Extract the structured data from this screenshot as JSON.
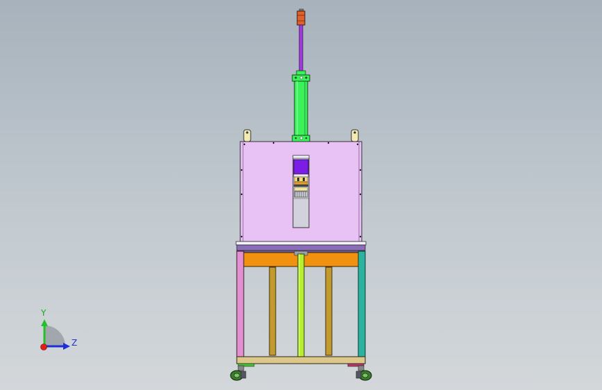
{
  "view": {
    "background_top": "#a7b2bc",
    "background_bottom": "#d3d7da"
  },
  "axes": {
    "y_label": "Y",
    "z_label": "Z",
    "y_color": "#22c02a",
    "z_color": "#1e2ed8",
    "x_color": "#e01e1e",
    "label_y_color": "#1ea41e",
    "label_z_color": "#1f31c8"
  },
  "model": {
    "cylinder_rod_color": "#a03cd8",
    "cylinder_barrel_color": "#3cf25a",
    "cylinder_cap_color": "#e0622a",
    "cabinet_color": "#e8c1f5",
    "window_press_color": "#7a1ee6",
    "table_top_color": "#8a6fb8",
    "crossbeam_color": "#f0920f",
    "leg_left_color": "#e48fd1",
    "leg_right_color": "#2bb3a0",
    "center_column_color": "#b5ef2f",
    "strut_color": "#c29a2e",
    "base_frame_color": "#dcc88a",
    "caster_color": "#3a7a2a",
    "bracket_color": "#f3eab4"
  }
}
